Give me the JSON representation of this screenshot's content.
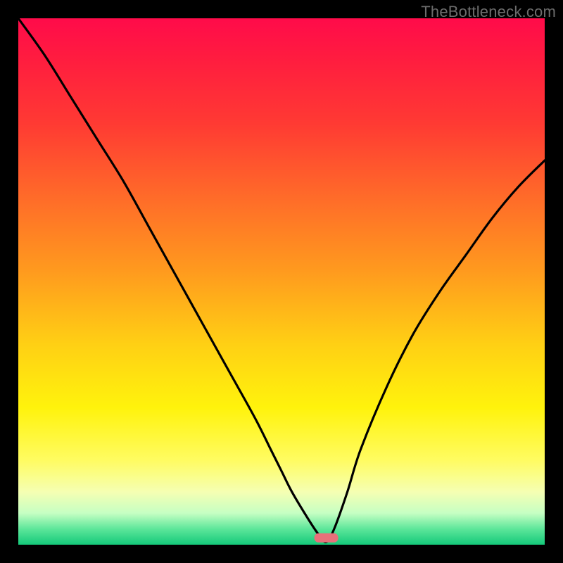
{
  "watermark": "TheBottleneck.com",
  "chart_data": {
    "type": "line",
    "title": "",
    "xlabel": "",
    "ylabel": "",
    "xlim": [
      0,
      100
    ],
    "ylim": [
      0,
      100
    ],
    "x": [
      0,
      5,
      10,
      15,
      20,
      25,
      30,
      35,
      40,
      45,
      48,
      50,
      52,
      55,
      57,
      58.5,
      60,
      62.5,
      65,
      70,
      75,
      80,
      85,
      90,
      95,
      100
    ],
    "y": [
      100,
      93,
      85,
      77,
      69,
      60,
      51,
      42,
      33,
      24,
      18,
      14,
      10,
      5,
      2,
      0.5,
      3,
      10,
      18,
      30,
      40,
      48,
      55,
      62,
      68,
      73
    ],
    "minimum": {
      "x": 58.5,
      "y": 0.5
    },
    "marker": {
      "x": 58.5,
      "y": 1.3,
      "shape": "rounded-rect",
      "color": "#e8707a"
    },
    "background_gradient": {
      "direction": "vertical",
      "stops": [
        {
          "pos": 0,
          "color": "#ff0b4a"
        },
        {
          "pos": 20,
          "color": "#ff3a33"
        },
        {
          "pos": 48,
          "color": "#ff9a1e"
        },
        {
          "pos": 74,
          "color": "#fff30c"
        },
        {
          "pos": 90,
          "color": "#f5ffb3"
        },
        {
          "pos": 100,
          "color": "#14c97a"
        }
      ]
    }
  }
}
